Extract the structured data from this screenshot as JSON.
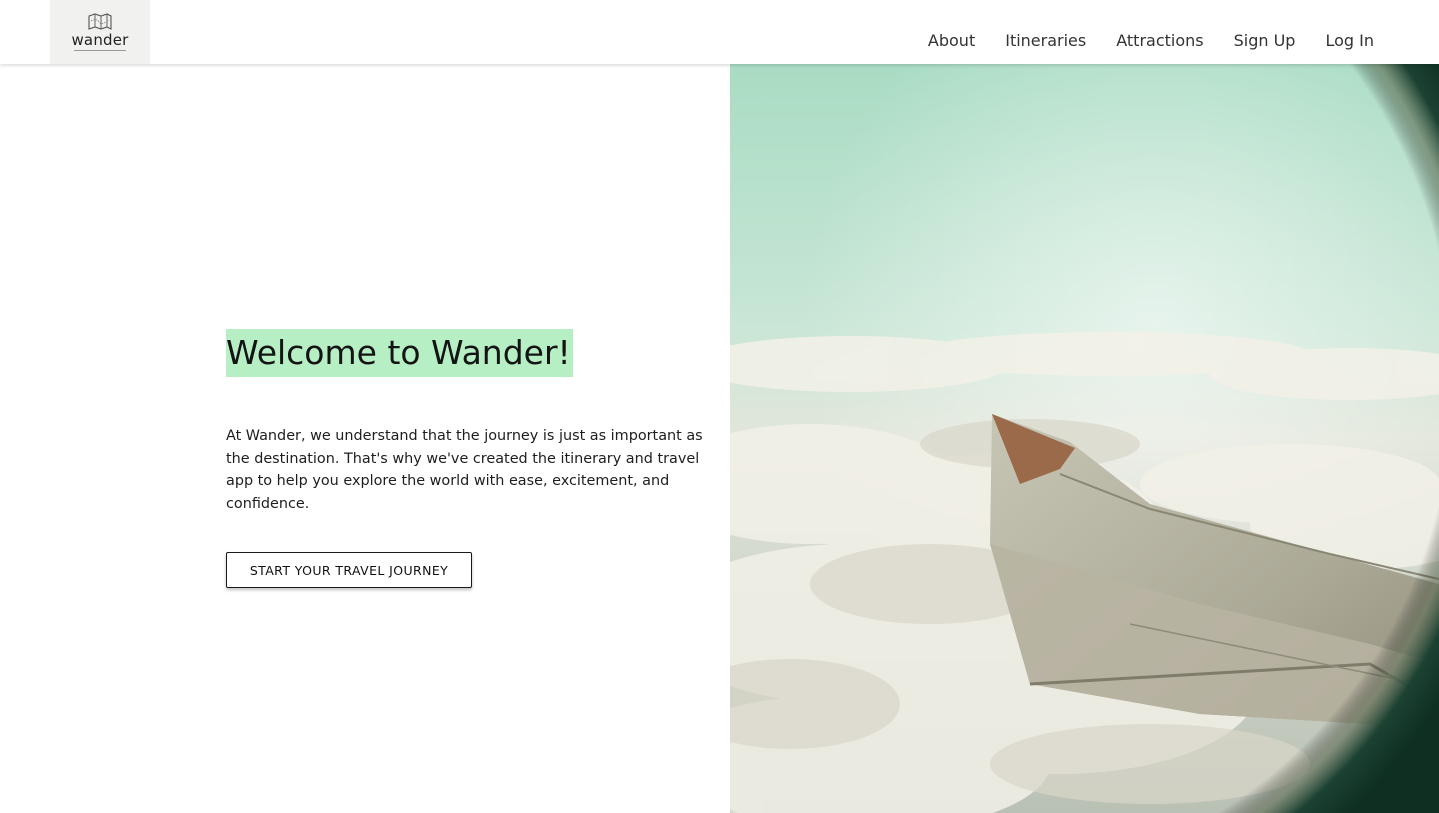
{
  "brand": {
    "name": "wander",
    "logo_icon": "folded-map-icon"
  },
  "nav": {
    "items": [
      {
        "label": "About"
      },
      {
        "label": "Itineraries"
      },
      {
        "label": "Attractions"
      },
      {
        "label": "Sign Up"
      },
      {
        "label": "Log In"
      }
    ]
  },
  "hero": {
    "title": "Welcome to Wander!",
    "description": "At Wander, we understand that the journey is just as important as the destination. That's why we've created the itinerary and travel app to help you explore the world with ease, excitement, and confidence.",
    "cta_label": "START YOUR TRAVEL JOURNEY",
    "image_subject": "airplane-wing-over-clouds"
  },
  "colors": {
    "title_highlight": "#b7efc5",
    "sky": "#bfe3d0",
    "window_frame": "#14392c"
  }
}
